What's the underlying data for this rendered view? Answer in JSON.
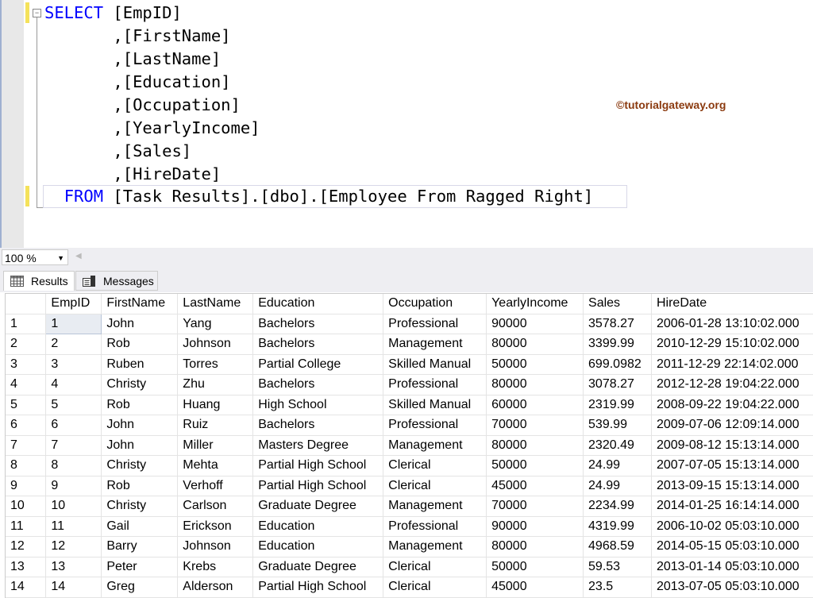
{
  "editor": {
    "lines": [
      {
        "kw": "SELECT",
        "text": " [EmpID]"
      },
      {
        "text": "       ,[FirstName]"
      },
      {
        "text": "       ,[LastName]"
      },
      {
        "text": "       ,[Education]"
      },
      {
        "text": "       ,[Occupation]"
      },
      {
        "text": "       ,[YearlyIncome]"
      },
      {
        "text": "       ,[Sales]"
      },
      {
        "text": "       ,[HireDate]"
      }
    ],
    "from_kw": "FROM",
    "from_text": " [Task Results].[dbo].[Employee From Ragged Right]",
    "watermark": "©tutorialgateway.org"
  },
  "zoom": {
    "value": "100 %"
  },
  "tabs": {
    "results": "Results",
    "messages": "Messages"
  },
  "grid": {
    "columns": [
      "EmpID",
      "FirstName",
      "LastName",
      "Education",
      "Occupation",
      "YearlyIncome",
      "Sales",
      "HireDate"
    ],
    "rows": [
      [
        "1",
        "1",
        "John",
        "Yang",
        "Bachelors",
        "Professional",
        "90000",
        "3578.27",
        "2006-01-28 13:10:02.000"
      ],
      [
        "2",
        "2",
        "Rob",
        "Johnson",
        "Bachelors",
        "Management",
        "80000",
        "3399.99",
        "2010-12-29 15:10:02.000"
      ],
      [
        "3",
        "3",
        "Ruben",
        "Torres",
        "Partial College",
        "Skilled Manual",
        "50000",
        "699.0982",
        "2011-12-29 22:14:02.000"
      ],
      [
        "4",
        "4",
        "Christy",
        "Zhu",
        "Bachelors",
        "Professional",
        "80000",
        "3078.27",
        "2012-12-28 19:04:22.000"
      ],
      [
        "5",
        "5",
        "Rob",
        "Huang",
        "High School",
        "Skilled Manual",
        "60000",
        "2319.99",
        "2008-09-22 19:04:22.000"
      ],
      [
        "6",
        "6",
        "John",
        "Ruiz",
        "Bachelors",
        "Professional",
        "70000",
        "539.99",
        "2009-07-06 12:09:14.000"
      ],
      [
        "7",
        "7",
        "John",
        "Miller",
        "Masters Degree",
        "Management",
        "80000",
        "2320.49",
        "2009-08-12 15:13:14.000"
      ],
      [
        "8",
        "8",
        "Christy",
        "Mehta",
        "Partial High School",
        "Clerical",
        "50000",
        "24.99",
        "2007-07-05 15:13:14.000"
      ],
      [
        "9",
        "9",
        "Rob",
        "Verhoff",
        "Partial High School",
        "Clerical",
        "45000",
        "24.99",
        "2013-09-15 15:13:14.000"
      ],
      [
        "10",
        "10",
        "Christy",
        "Carlson",
        "Graduate Degree",
        "Management",
        "70000",
        "2234.99",
        "2014-01-25 16:14:14.000"
      ],
      [
        "11",
        "11",
        "Gail",
        "Erickson",
        "Education",
        "Professional",
        "90000",
        "4319.99",
        "2006-10-02 05:03:10.000"
      ],
      [
        "12",
        "12",
        "Barry",
        "Johnson",
        "Education",
        "Management",
        "80000",
        "4968.59",
        "2014-05-15 05:03:10.000"
      ],
      [
        "13",
        "13",
        "Peter",
        "Krebs",
        "Graduate Degree",
        "Clerical",
        "50000",
        "59.53",
        "2013-01-14 05:03:10.000"
      ],
      [
        "14",
        "14",
        "Greg",
        "Alderson",
        "Partial High School",
        "Clerical",
        "45000",
        "23.5",
        "2013-07-05 05:03:10.000"
      ]
    ]
  }
}
